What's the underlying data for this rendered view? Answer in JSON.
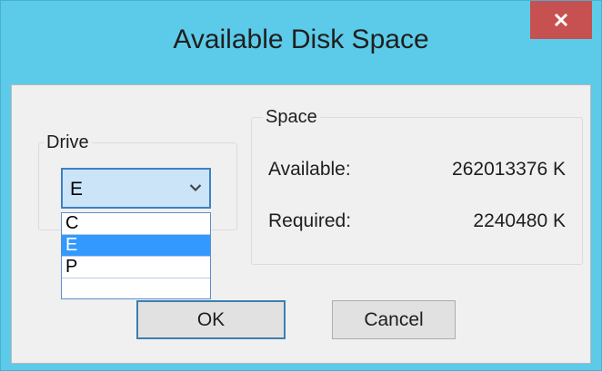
{
  "window": {
    "title": "Available Disk Space",
    "close_label": "x"
  },
  "drive": {
    "group_label": "Drive",
    "selected": "E",
    "options": [
      "C",
      "E",
      "P"
    ],
    "highlighted_index": 1
  },
  "space": {
    "group_label": "Space",
    "available_label": "Available:",
    "available_value": "262013376 K",
    "required_label": "Required:",
    "required_value": "2240480 K"
  },
  "buttons": {
    "ok_label": "OK",
    "cancel_label": "Cancel"
  },
  "colors": {
    "titlebar": "#5ccbe9",
    "close_button": "#c75050",
    "selection": "#3399ff",
    "focus_border": "#3e80c4"
  }
}
